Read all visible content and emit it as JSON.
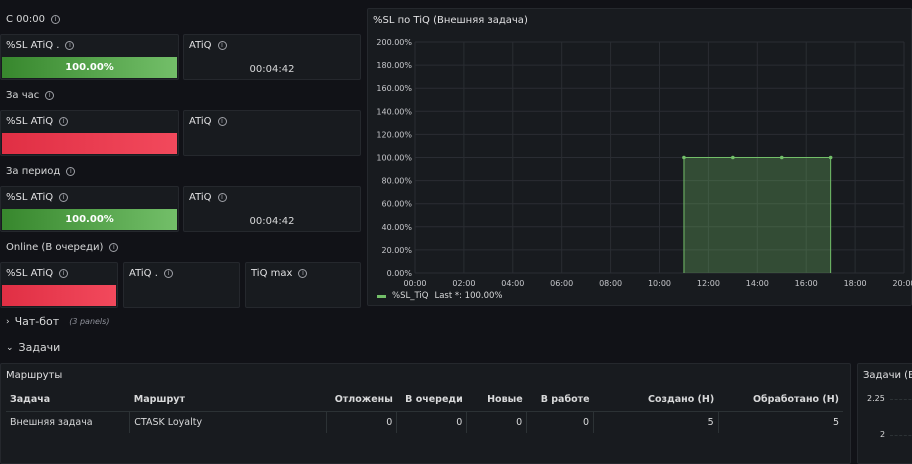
{
  "rows": {
    "since_midnight": "С 00:00",
    "per_hour": "За час",
    "per_period": "За период",
    "online": "Online (В очереди)"
  },
  "stats": {
    "r1": {
      "sl_title": "%SL ATiQ .",
      "sl_value": "100.00%",
      "atiq_title": "ATiQ",
      "atiq_value": "00:04:42"
    },
    "r2": {
      "sl_title": "%SL ATiQ",
      "sl_value": "",
      "atiq_title": "ATiQ",
      "atiq_value": ""
    },
    "r3": {
      "sl_title": "%SL ATiQ",
      "sl_value": "100.00%",
      "atiq_title": "ATiQ",
      "atiq_value": "00:04:42"
    },
    "r4": {
      "sl_title": "%SL ATiQ",
      "sl_value": "",
      "atiq_title": "ATiQ .",
      "atiq_value": "",
      "tiq_title": "TiQ max",
      "tiq_value": ""
    }
  },
  "colors": {
    "ok": "#73bf69",
    "bad": "#f2495c",
    "background": "#111217",
    "panel": "#181b1f"
  },
  "chart_data": {
    "type": "area",
    "title": "%SL по TiQ (Внешняя задача)",
    "x_ticks": [
      "00:00",
      "02:00",
      "04:00",
      "06:00",
      "08:00",
      "10:00",
      "12:00",
      "14:00",
      "16:00",
      "18:00",
      "20:00"
    ],
    "y_ticks": [
      "0.00%",
      "20.00%",
      "40.00%",
      "60.00%",
      "80.00%",
      "100.00%",
      "120.00%",
      "140.00%",
      "160.00%",
      "180.00%",
      "200.00%"
    ],
    "xlim": [
      0,
      20
    ],
    "ylim": [
      0,
      200
    ],
    "x": [
      11,
      13,
      15,
      17
    ],
    "series": [
      {
        "name": "%SL_TiQ",
        "values": [
          100,
          100,
          100,
          100
        ],
        "color": "#73bf69"
      }
    ],
    "legend": {
      "label": "%SL_TiQ",
      "stat": "Last *: 100.00%"
    },
    "grid": true
  },
  "sections": {
    "chatbot": {
      "label": "Чат-бот",
      "note": "(3 panels)"
    },
    "tasks": {
      "label": "Задачи"
    }
  },
  "routes": {
    "title": "Маршруты",
    "columns": [
      "Задача",
      "Маршрут",
      "Отложены",
      "В очереди",
      "Новые",
      "В работе",
      "Создано (Н)",
      "Обработано (Н)"
    ],
    "rows": [
      [
        "Внешняя задача",
        "CTASK Loyalty",
        "0",
        "0",
        "0",
        "0",
        "5",
        "5"
      ]
    ]
  },
  "tasks_panel": {
    "title": "Задачи (В",
    "y_ticks": [
      "2.25",
      "2"
    ]
  }
}
